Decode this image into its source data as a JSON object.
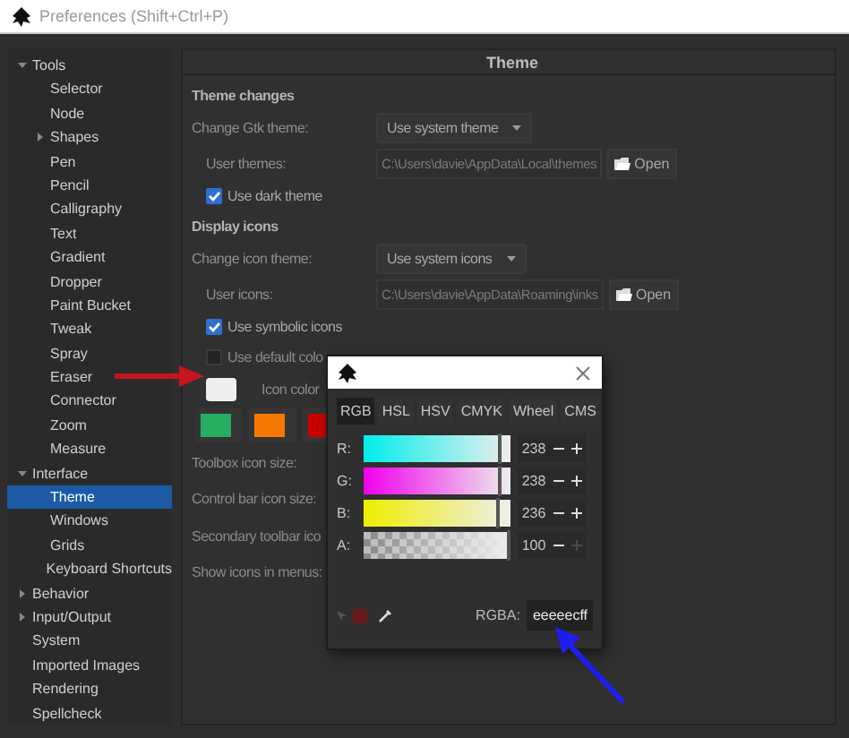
{
  "window": {
    "title": "Preferences (Shift+Ctrl+P)"
  },
  "sidebar": {
    "items": [
      {
        "label": "Tools",
        "expanded": true,
        "selected": false,
        "children": [
          {
            "label": "Selector",
            "selected": false
          },
          {
            "label": "Node",
            "selected": false
          },
          {
            "label": "Shapes",
            "expanded": false,
            "selected": false
          },
          {
            "label": "Pen",
            "selected": false
          },
          {
            "label": "Pencil",
            "selected": false
          },
          {
            "label": "Calligraphy",
            "selected": false
          },
          {
            "label": "Text",
            "selected": false
          },
          {
            "label": "Gradient",
            "selected": false
          },
          {
            "label": "Dropper",
            "selected": false
          },
          {
            "label": "Paint Bucket",
            "selected": false
          },
          {
            "label": "Tweak",
            "selected": false
          },
          {
            "label": "Spray",
            "selected": false
          },
          {
            "label": "Eraser",
            "selected": false
          },
          {
            "label": "Connector",
            "selected": false
          },
          {
            "label": "Zoom",
            "selected": false
          },
          {
            "label": "Measure",
            "selected": false
          }
        ]
      },
      {
        "label": "Interface",
        "expanded": true,
        "selected": false,
        "children": [
          {
            "label": "Theme",
            "selected": true
          },
          {
            "label": "Windows",
            "selected": false
          },
          {
            "label": "Grids",
            "selected": false
          },
          {
            "label": "Keyboard Shortcuts",
            "selected": false
          }
        ]
      },
      {
        "label": "Behavior",
        "expanded": false,
        "selected": false
      },
      {
        "label": "Input/Output",
        "expanded": false,
        "selected": false
      },
      {
        "label": "System",
        "selected": false
      },
      {
        "label": "Imported Images",
        "selected": false
      },
      {
        "label": "Rendering",
        "selected": false
      },
      {
        "label": "Spellcheck",
        "selected": false
      }
    ]
  },
  "panel": {
    "title": "Theme",
    "sections": [
      {
        "title": "Theme changes",
        "rows": [
          {
            "kind": "dropdown",
            "label": "Change Gtk theme:",
            "value": "Use system theme"
          },
          {
            "kind": "path",
            "label": "User themes:",
            "value": "C:\\Users\\davie\\AppData\\Local\\themes",
            "button": "Open"
          },
          {
            "kind": "checkbox",
            "label": "Use dark theme",
            "checked": true
          }
        ]
      },
      {
        "title": "Display icons",
        "rows": [
          {
            "kind": "dropdown",
            "label": "Change icon theme:",
            "value": "Use system icons"
          },
          {
            "kind": "path",
            "label": "User icons:",
            "value": "C:\\Users\\davie\\AppData\\Roaming\\inks",
            "button": "Open"
          },
          {
            "kind": "checkbox",
            "label": "Use symbolic icons",
            "checked": true
          },
          {
            "kind": "checkbox",
            "label": "Use default colo",
            "checked": false
          },
          {
            "kind": "color",
            "label": "Icon color",
            "color": "#eeeeec"
          },
          {
            "kind": "swatches",
            "swatches": [
              {
                "color": "#27ae60"
              },
              {
                "color": "#f57900"
              },
              {
                "color": "#cc0000"
              }
            ]
          },
          {
            "kind": "label",
            "label": "Toolbox icon size:"
          },
          {
            "kind": "label",
            "label": "Control bar icon size:"
          },
          {
            "kind": "label",
            "label": "Secondary toolbar ico"
          },
          {
            "kind": "label",
            "label": "Show icons in menus:"
          }
        ]
      }
    ]
  },
  "color_dialog": {
    "tabs": [
      {
        "label": "RGB",
        "selected": true
      },
      {
        "label": "HSL",
        "selected": false
      },
      {
        "label": "HSV",
        "selected": false
      },
      {
        "label": "CMYK",
        "selected": false
      },
      {
        "label": "Wheel",
        "selected": false
      },
      {
        "label": "CMS",
        "selected": false
      }
    ],
    "channels": [
      {
        "kind": "red",
        "name": "R:",
        "value": "238",
        "level": 0.933,
        "plus_disabled": false
      },
      {
        "kind": "green",
        "name": "G:",
        "value": "238",
        "level": 0.933,
        "plus_disabled": false
      },
      {
        "kind": "blue",
        "name": "B:",
        "value": "236",
        "level": 0.925,
        "plus_disabled": false
      },
      {
        "kind": "alpha",
        "name": "A:",
        "value": "100",
        "level": 1,
        "plus_disabled": true
      }
    ],
    "rgba_label": "RGBA:",
    "rgba": "eeeeecff"
  }
}
